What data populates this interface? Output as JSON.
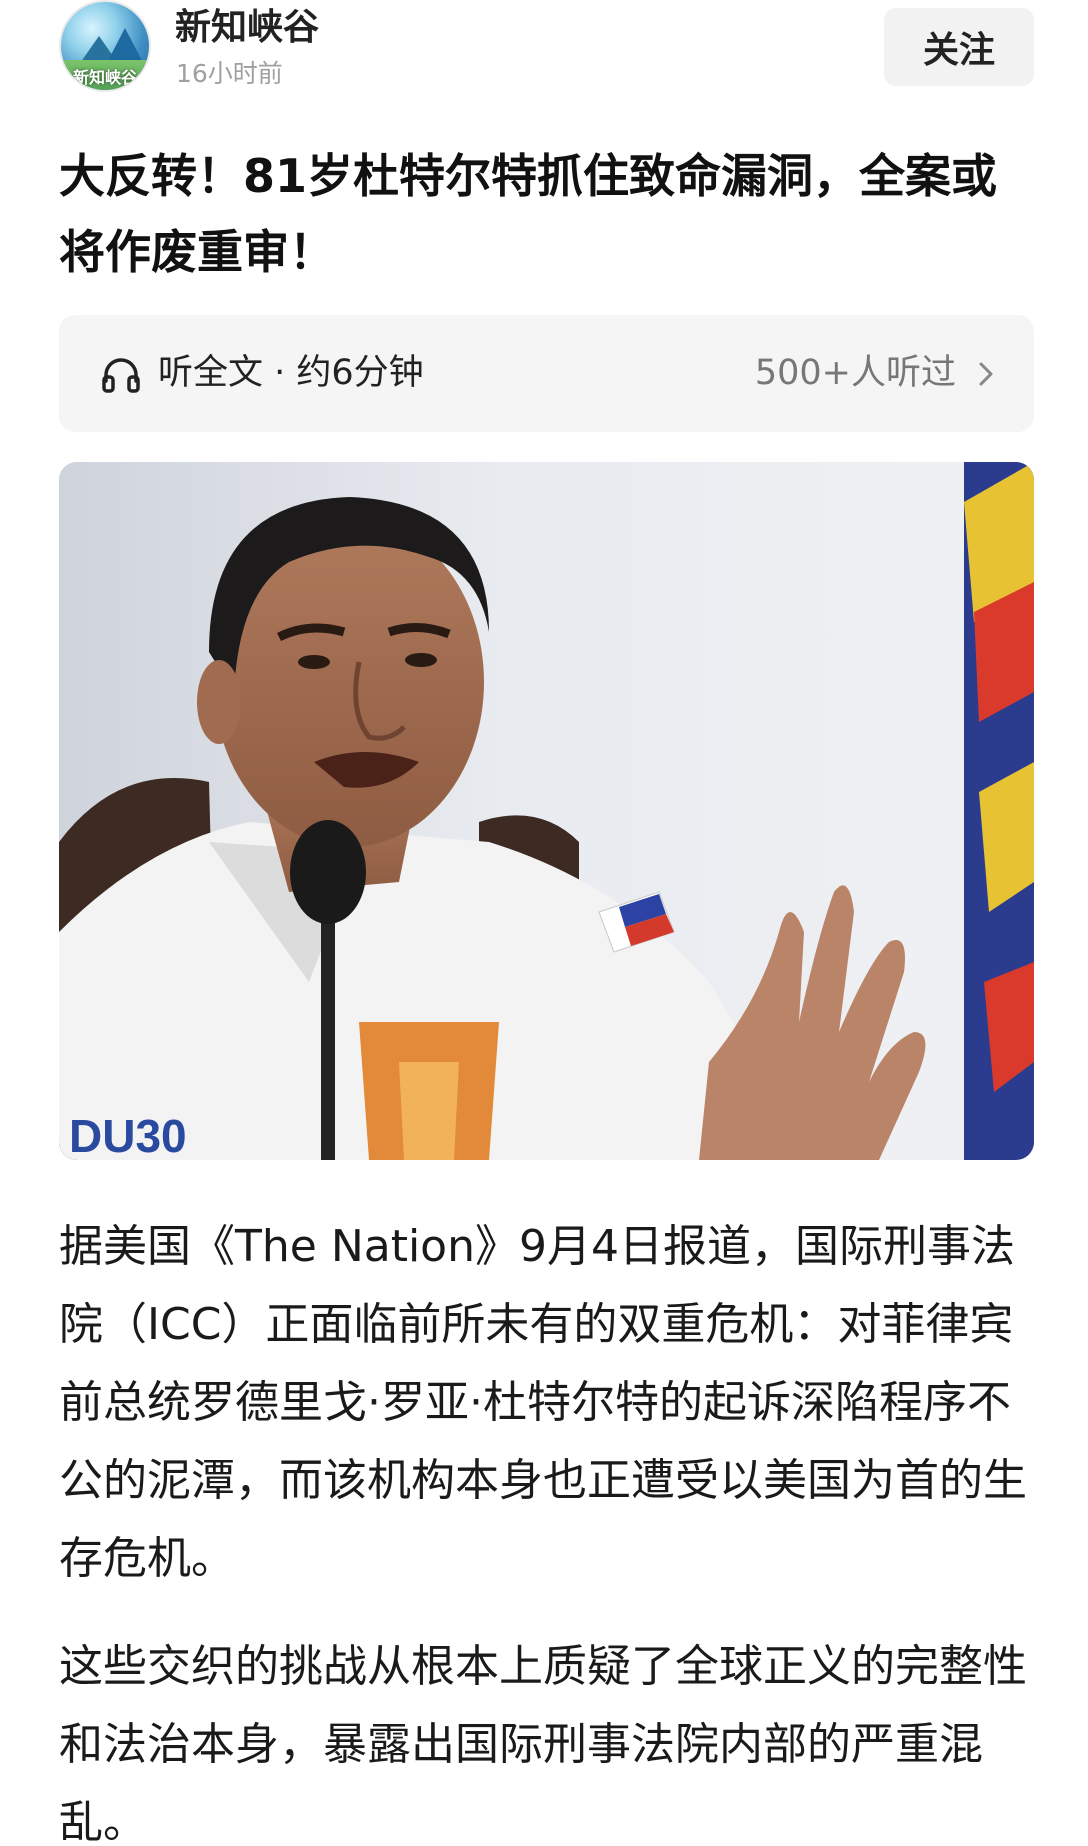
{
  "author": {
    "name": "新知峡谷",
    "avatar_text": "新知峡谷",
    "time": "16小时前",
    "follow_label": "关注"
  },
  "article": {
    "title": "大反转！81岁杜特尔特抓住致命漏洞，全案或将作废重审！",
    "listen": {
      "label": "听全文 · 约6分钟",
      "count": "500+人听过"
    },
    "photo": {
      "description_icon": "photo",
      "shirt_text": "DU30"
    },
    "paragraphs": [
      "据美国《The Nation》9月4日报道，国际刑事法院（ICC）正面临前所未有的双重危机：对菲律宾前总统罗德里戈·罗亚·杜特尔特的起诉深陷程序不公的泥潭，而该机构本身也正遭受以美国为首的生存危机。",
      "这些交织的挑战从根本上质疑了全球正义的完整性和法治本身，暴露出国际刑事法院内部的严重混乱。"
    ]
  },
  "colors": {
    "listen_bar_bg": "#f5f5f5",
    "follow_bg": "#f2f2f2",
    "muted_text": "#a0a0a0"
  }
}
